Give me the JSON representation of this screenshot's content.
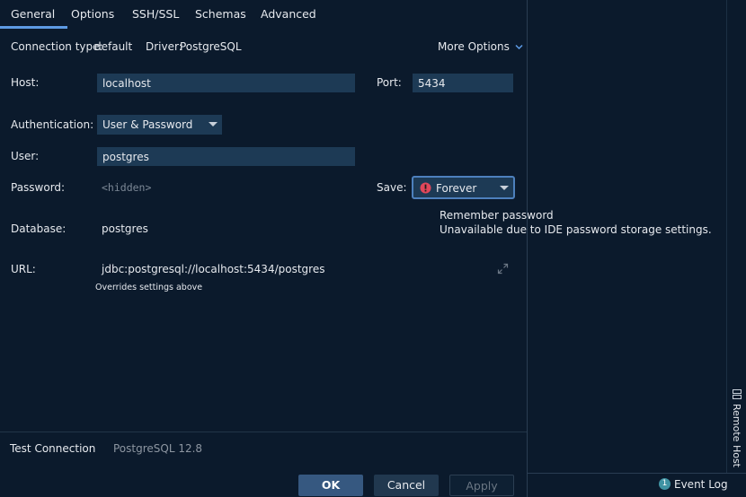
{
  "tabs": [
    "General",
    "Options",
    "SSH/SSL",
    "Schemas",
    "Advanced"
  ],
  "connection": {
    "type_label": "Connection type:",
    "type_value": "default",
    "driver_label": "Driver:",
    "driver_value": "PostgreSQL",
    "more_options": "More Options"
  },
  "host": {
    "label": "Host:",
    "value": "localhost"
  },
  "port": {
    "label": "Port:",
    "value": "5434"
  },
  "auth": {
    "label": "Authentication:",
    "value": "User & Password"
  },
  "user": {
    "label": "User:",
    "value": "postgres"
  },
  "password": {
    "label": "Password:",
    "placeholder": "<hidden>"
  },
  "save": {
    "label": "Save:",
    "value": "Forever"
  },
  "tooltip": {
    "line1": "Remember password",
    "line2": "Unavailable due to IDE password storage settings."
  },
  "database": {
    "label": "Database:",
    "value": "postgres"
  },
  "url": {
    "label": "URL:",
    "value": "jdbc:postgresql://localhost:5434/postgres",
    "hint": "Overrides settings above"
  },
  "footer": {
    "test_connection": "Test Connection",
    "server_version": "PostgreSQL 12.8"
  },
  "buttons": {
    "ok": "OK",
    "cancel": "Cancel",
    "apply": "Apply"
  },
  "side_panel": {
    "remote_host": "Remote Host",
    "event_log": "Event Log",
    "event_log_count": "1"
  },
  "colors": {
    "background": "#0b1a2c",
    "field": "#1d3a55",
    "link": "#5e9de8",
    "primary_button": "#365880",
    "error": "#e0475b"
  }
}
